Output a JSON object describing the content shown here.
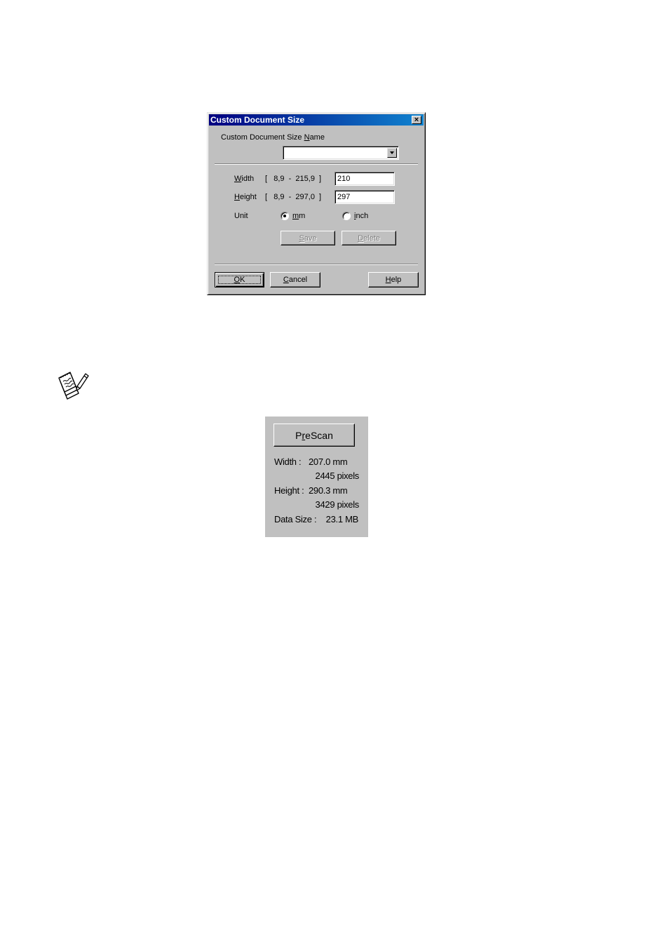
{
  "dialog": {
    "title": "Custom Document Size",
    "close_label": "×",
    "name_label_pre": "Custom Document Size ",
    "name_label_accel": "N",
    "name_label_post": "ame",
    "name_combo_value": "",
    "width": {
      "label_accel": "W",
      "label_rest": "idth",
      "range": "[   8,9  -  215,9  ]",
      "value": "210"
    },
    "height": {
      "label_accel": "H",
      "label_rest": "eight",
      "range": "[   8,9  -  297,0  ]",
      "value": "297"
    },
    "unit": {
      "label": "Unit",
      "options": [
        {
          "accel": "m",
          "rest": "m",
          "selected": true
        },
        {
          "accel": "i",
          "rest": "nch",
          "selected": false
        }
      ]
    },
    "buttons": {
      "save": {
        "accel": "S",
        "rest": "ave",
        "disabled": true
      },
      "delete": {
        "accel": "D",
        "rest": "elete",
        "disabled": true
      },
      "ok": {
        "accel": "O",
        "rest": "K"
      },
      "cancel": {
        "accel": "C",
        "rest": "ancel"
      },
      "help": {
        "accel": "H",
        "rest": "elp"
      }
    }
  },
  "note": {
    "icon": "note-pencil-icon"
  },
  "scan_panel": {
    "prescan": {
      "pre": "P",
      "accel": "r",
      "rest": "eScan"
    },
    "width_label": "Width :",
    "width_mm": "207.0 mm",
    "width_pixels": "2445 pixels",
    "height_label": "Height :",
    "height_mm": "290.3 mm",
    "height_pixels": "3429 pixels",
    "data_size_label": "Data Size :",
    "data_size_value": "23.1 MB"
  },
  "colors": {
    "dialog_face": "#c0c0c0",
    "titlebar_start": "#000080",
    "titlebar_end": "#1084d0"
  }
}
